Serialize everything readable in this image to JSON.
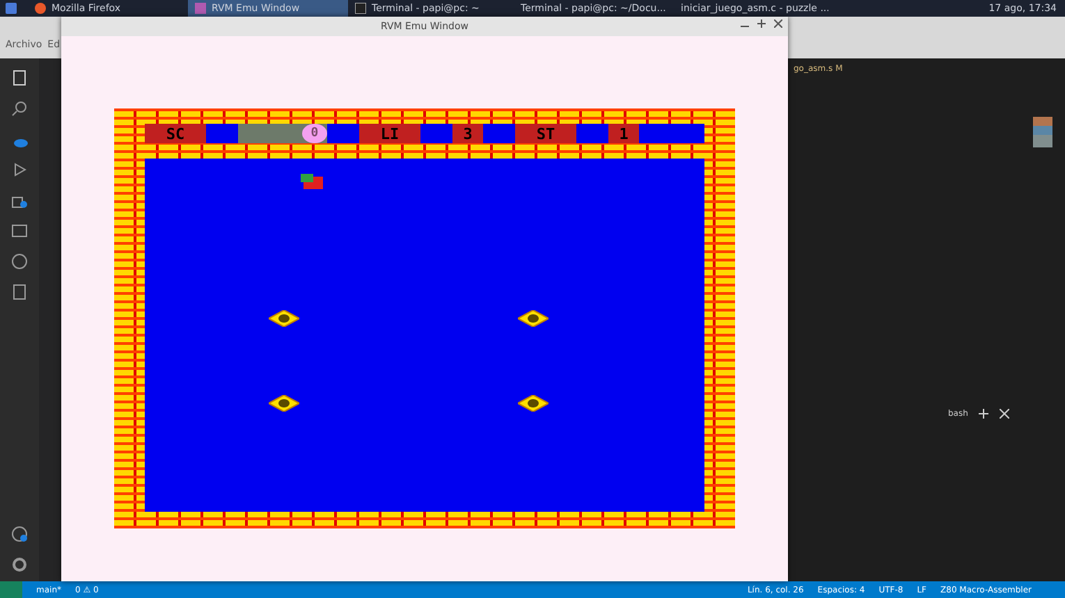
{
  "taskbar": {
    "apps": [
      {
        "label": "Mozilla Firefox",
        "selected": false,
        "kind": "firefox"
      },
      {
        "label": "RVM Emu Window",
        "selected": true,
        "kind": "emu"
      },
      {
        "label": "Terminal - papi@pc: ~",
        "selected": false,
        "kind": "terminal"
      },
      {
        "label": "Terminal - papi@pc: ~/Docu...",
        "selected": false,
        "kind": "terminal"
      },
      {
        "label": "iniciar_juego_asm.c - puzzle ...",
        "selected": false,
        "kind": "code"
      }
    ],
    "clock": "17 ago, 17:34"
  },
  "editor": {
    "menu": [
      "Archivo",
      "Ed"
    ],
    "tab": "go_asm.s M",
    "terminal_shell": "bash"
  },
  "window": {
    "title": "RVM Emu Window"
  },
  "game": {
    "hud": [
      {
        "kind": "label",
        "text": "SC"
      },
      {
        "kind": "score",
        "text": "0"
      },
      {
        "kind": "label",
        "text": "LI"
      },
      {
        "kind": "value",
        "text": "3"
      },
      {
        "kind": "label",
        "text": "ST"
      },
      {
        "kind": "value",
        "text": "1"
      }
    ]
  },
  "status_bar": {
    "branch": "main*",
    "problems": "0 ⚠ 0",
    "items": [
      "Lín. 6, col. 26",
      "Espacios: 4",
      "UTF-8",
      "LF",
      "Z80 Macro-Assembler"
    ]
  }
}
